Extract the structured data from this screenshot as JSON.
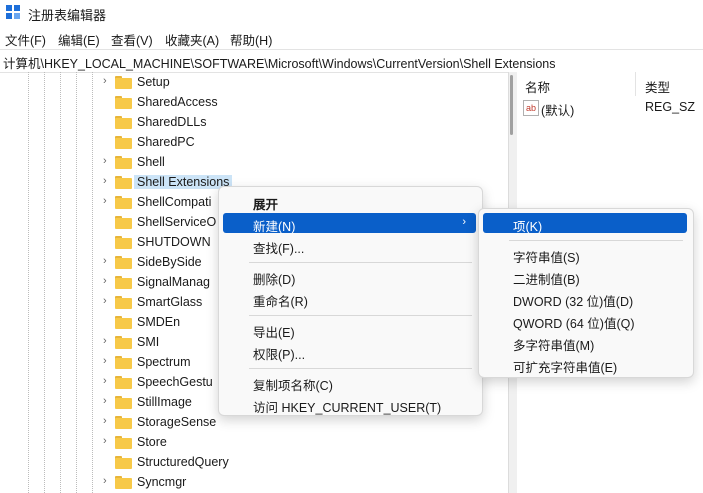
{
  "window": {
    "title": "注册表编辑器"
  },
  "menubar": [
    "文件(F)",
    "编辑(E)",
    "查看(V)",
    "收藏夹(A)",
    "帮助(H)"
  ],
  "address": "计算机\\HKEY_LOCAL_MACHINE\\SOFTWARE\\Microsoft\\Windows\\CurrentVersion\\Shell Extensions",
  "tree": [
    {
      "label": "Setup",
      "expandable": true
    },
    {
      "label": "SharedAccess",
      "expandable": false
    },
    {
      "label": "SharedDLLs",
      "expandable": false
    },
    {
      "label": "SharedPC",
      "expandable": false
    },
    {
      "label": "Shell",
      "expandable": true
    },
    {
      "label": "Shell Extensions",
      "expandable": true,
      "selected": true
    },
    {
      "label": "ShellCompati",
      "expandable": true
    },
    {
      "label": "ShellServiceO",
      "expandable": false
    },
    {
      "label": "SHUTDOWN",
      "expandable": false
    },
    {
      "label": "SideBySide",
      "expandable": true
    },
    {
      "label": "SignalManag",
      "expandable": true
    },
    {
      "label": "SmartGlass",
      "expandable": true
    },
    {
      "label": "SMDEn",
      "expandable": false
    },
    {
      "label": "SMI",
      "expandable": true
    },
    {
      "label": "Spectrum",
      "expandable": true
    },
    {
      "label": "SpeechGestu",
      "expandable": true
    },
    {
      "label": "StillImage",
      "expandable": true
    },
    {
      "label": "StorageSense",
      "expandable": true
    },
    {
      "label": "Store",
      "expandable": true
    },
    {
      "label": "StructuredQuery",
      "expandable": false
    },
    {
      "label": "Syncmgr",
      "expandable": true
    }
  ],
  "values": {
    "headers": {
      "name": "名称",
      "type": "类型"
    },
    "rows": [
      {
        "name": "(默认)",
        "type": "REG_SZ",
        "icon": "string-value-icon"
      }
    ]
  },
  "context_menu": {
    "items": [
      {
        "label": "展开",
        "bold": true
      },
      {
        "label": "新建(N)",
        "highlighted": true,
        "submenu": true
      },
      {
        "label": "查找(F)..."
      },
      {
        "sep": true
      },
      {
        "label": "删除(D)"
      },
      {
        "label": "重命名(R)"
      },
      {
        "sep": true
      },
      {
        "label": "导出(E)"
      },
      {
        "label": "权限(P)..."
      },
      {
        "sep": true
      },
      {
        "label": "复制项名称(C)"
      },
      {
        "label": "访问 HKEY_CURRENT_USER(T)"
      }
    ]
  },
  "submenu": {
    "items": [
      {
        "label": "项(K)",
        "highlighted": true
      },
      {
        "sep": true
      },
      {
        "label": "字符串值(S)"
      },
      {
        "label": "二进制值(B)"
      },
      {
        "label": "DWORD (32 位)值(D)"
      },
      {
        "label": "QWORD (64 位)值(Q)"
      },
      {
        "label": "多字符串值(M)"
      },
      {
        "label": "可扩充字符串值(E)"
      }
    ]
  },
  "colors": {
    "accent": "#0a5fc9",
    "selection": "#cce4f7",
    "folder": "#f7c948"
  }
}
